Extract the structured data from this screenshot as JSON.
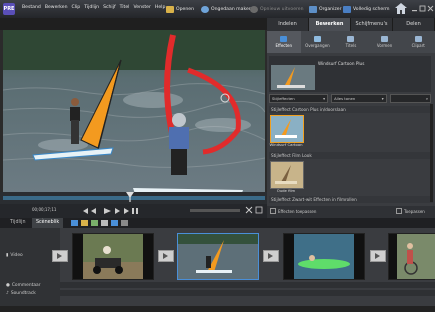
{
  "app": {
    "logo_text": "PRE"
  },
  "menu": [
    "Bestand",
    "Bewerken",
    "Clip",
    "Tijdlijn",
    "Schijf",
    "Titel",
    "Venster",
    "Help"
  ],
  "toolbar": {
    "open": "Openen",
    "undo": "Ongedaan maken",
    "redo": "Opnieuw uitvoeren",
    "organizer": "Organizer",
    "full_screen": "Volledig scherm"
  },
  "right_panel": {
    "tabs": [
      "Indelen",
      "Bewerken",
      "Schijfmenu's",
      "Delen"
    ],
    "active_tab": "Bewerken",
    "subtabs": [
      "Effecten",
      "Overgangen",
      "Titels",
      "Vormen",
      "Clipart"
    ],
    "active_subtab": "Effecten",
    "preset_name": "Windsurf Cartoon Plus",
    "dropdown_left": "Stijleffecten",
    "dropdown_right": "Alles tonen",
    "section1": "Stijleffect Cartoon Plus in/doorslaan",
    "thumb1_label": "Windsurf Cartoon",
    "section2": "Stijleffect Film Look",
    "thumb2_label": "Oude film",
    "section3": "Stijleffect Zwart-wit Effecten in filmrollen",
    "apply_label": "Effecten toepassen",
    "toggle_label": "Toepassen"
  },
  "monitor": {
    "timecode": "00;00;17;11"
  },
  "lower": {
    "tabs": [
      "Tijdlijn",
      "Scèneblik"
    ],
    "active_tab": "Scèneblik",
    "rows": [
      "Video",
      "Commentaar",
      "Soundtrack"
    ]
  }
}
